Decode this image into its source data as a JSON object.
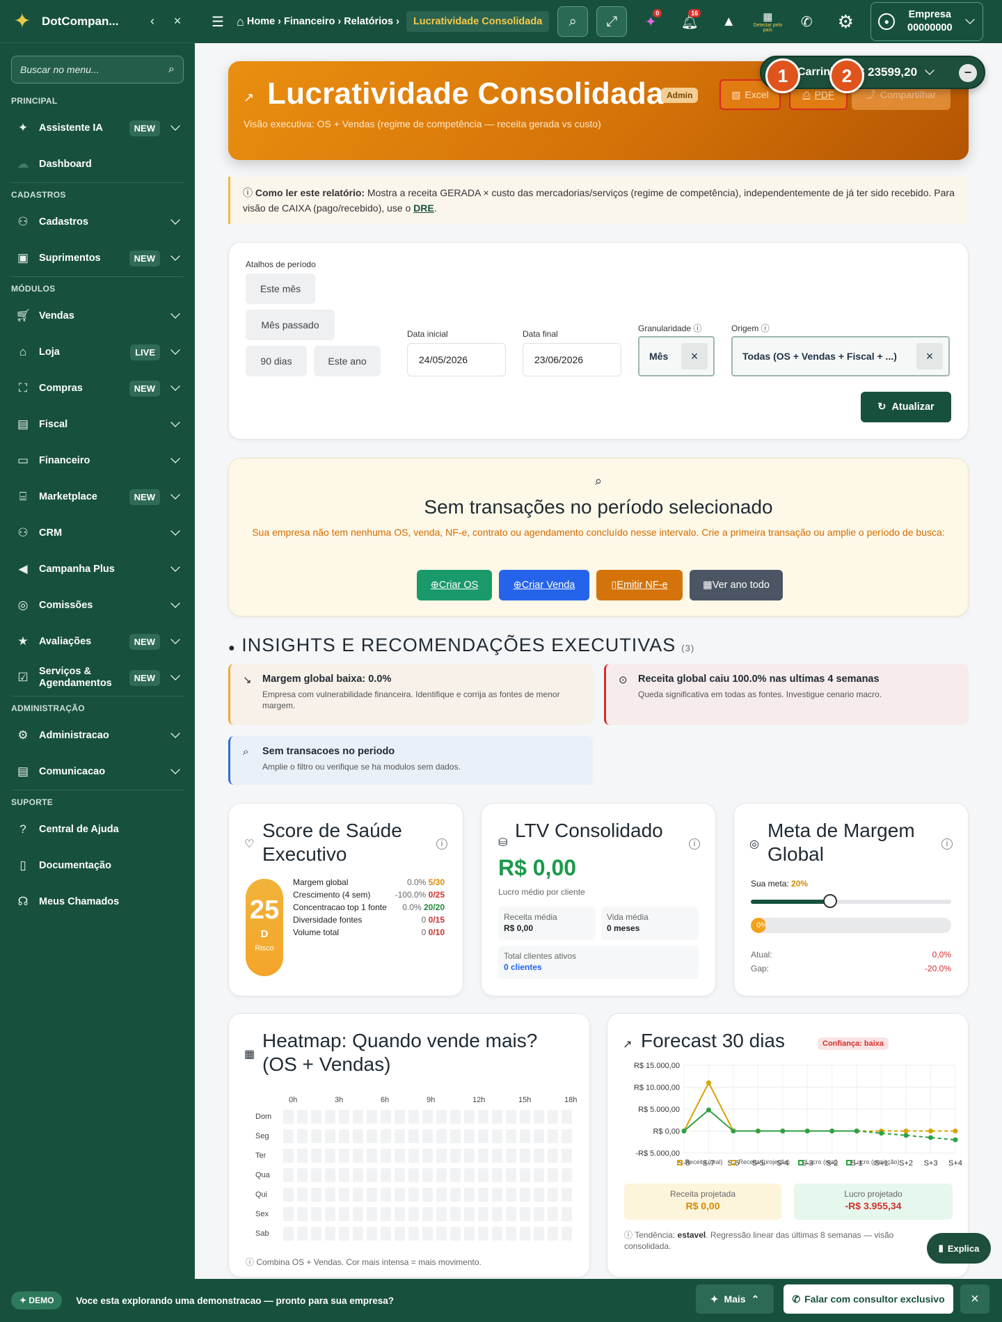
{
  "sidebar": {
    "brand": "DotCompan...",
    "search_placeholder": "Buscar no menu...",
    "sections": {
      "principal": "PRINCIPAL",
      "cadastros": "CADASTROS",
      "modulos": "MÓDULOS",
      "administracao": "ADMINISTRAÇÃO",
      "suporte": "SUPORTE"
    },
    "items": {
      "assistente": {
        "label": "Assistente IA",
        "badge": "NEW"
      },
      "dashboard": {
        "label": "Dashboard"
      },
      "cadastros": {
        "label": "Cadastros"
      },
      "suprimentos": {
        "label": "Suprimentos",
        "badge": "NEW"
      },
      "vendas": {
        "label": "Vendas"
      },
      "loja": {
        "label": "Loja",
        "badge": "LIVE"
      },
      "compras": {
        "label": "Compras",
        "badge": "NEW"
      },
      "fiscal": {
        "label": "Fiscal"
      },
      "financeiro": {
        "label": "Financeiro"
      },
      "marketplace": {
        "label": "Marketplace",
        "badge": "NEW"
      },
      "crm": {
        "label": "CRM"
      },
      "campanha": {
        "label": "Campanha Plus"
      },
      "comissoes": {
        "label": "Comissões"
      },
      "avaliacoes": {
        "label": "Avaliações",
        "badge": "NEW"
      },
      "servicos": {
        "label": "Serviços & Agendamentos",
        "badge": "NEW"
      },
      "administracao": {
        "label": "Administracao"
      },
      "comunicacao": {
        "label": "Comunicacao"
      },
      "ajuda": {
        "label": "Central de Ajuda"
      },
      "documentacao": {
        "label": "Documentação"
      },
      "chamados": {
        "label": "Meus Chamados"
      }
    }
  },
  "topbar": {
    "crumb_home": "Home",
    "crumb_financeiro": "Financeiro",
    "crumb_relatorios": "Relatórios",
    "crumb_active": "Lucratividade Consolidada",
    "notif_ai": "0",
    "notif_bell": "16",
    "detect_label": "Detectar pelo país",
    "company_label": "Empresa",
    "company_id": "00000000"
  },
  "cart": {
    "label": "Carrinho",
    "value": "R$ 23599,20"
  },
  "markers": {
    "one": "1",
    "two": "2"
  },
  "hero": {
    "title": "Lucratividade Consolidada",
    "badge": "Admin",
    "subtitle": "Visão executiva: OS + Vendas (regime de competência — receita gerada vs custo)",
    "btn_excel": "Excel",
    "btn_pdf": "PDF",
    "btn_share": "Compartilhar"
  },
  "info": {
    "bold": "Como ler este relatório:",
    "text": " Mostra a receita GERADA × custo das mercadorias/serviços (regime de competência), independentemente de já ter sido recebido. Para visão de CAIXA (pago/recebido), use o ",
    "link": "DRE",
    "end": "."
  },
  "filters": {
    "shortcuts_label": "Atalhos de período",
    "shortcuts": [
      "Este mês",
      "Mês passado",
      "90 dias",
      "Este ano"
    ],
    "start_label": "Data inicial",
    "start_value": "24/05/2026",
    "end_label": "Data final",
    "end_value": "23/06/2026",
    "gran_label": "Granularidade",
    "gran_value": "Mês",
    "origin_label": "Origem",
    "origin_value": "Todas (OS + Vendas + Fiscal + ...)",
    "update_btn": "Atualizar"
  },
  "empty": {
    "title": "Sem transações no período selecionado",
    "desc": "Sua empresa não tem nenhuma OS, venda, NF-e, contrato ou agendamento concluído nesse intervalo. Crie a primeira transação ou amplie o período de busca:",
    "btn_os": "Criar OS",
    "btn_venda": "Criar Venda",
    "btn_nfe": "Emitir NF-e",
    "btn_ano": "Ver ano todo"
  },
  "insights": {
    "title": "INSIGHTS E RECOMENDAÇÕES EXECUTIVAS",
    "count": "(3)",
    "items": [
      {
        "title": "Margem global baixa: 0.0%",
        "desc": "Empresa com vulnerabilidade financeira. Identifique e corrija as fontes de menor margem."
      },
      {
        "title": "Receita global caiu 100.0% nas ultimas 4 semanas",
        "desc": "Queda significativa em todas as fontes. Investigue cenario macro."
      },
      {
        "title": "Sem transacoes no periodo",
        "desc": "Amplie o filtro ou verifique se ha modulos sem dados."
      }
    ]
  },
  "score": {
    "title": "Score de Saúde Executivo",
    "value": "25",
    "grade": "D",
    "status": "Risco",
    "rows": [
      {
        "label": "Margem global",
        "pct": "0.0%",
        "pts": "5/30",
        "color": "#e08a00"
      },
      {
        "label": "Crescimento (4 sem)",
        "pct": "-100.0%",
        "pts": "0/25",
        "color": "#d0302c"
      },
      {
        "label": "Concentracao top 1 fonte",
        "pct": "0.0%",
        "pts": "20/20",
        "color": "#1c8a3a"
      },
      {
        "label": "Diversidade fontes",
        "pct": "0",
        "pts": "0/15",
        "color": "#d0302c"
      },
      {
        "label": "Volume total",
        "pct": "0",
        "pts": "0/10",
        "color": "#d0302c"
      }
    ]
  },
  "ltv": {
    "title": "LTV Consolidado",
    "value": "R$ 0,00",
    "sub": "Lucro médio por cliente",
    "rec_label": "Receita média",
    "rec_value": "R$ 0,00",
    "vida_label": "Vida média",
    "vida_value": "0 meses",
    "clients_label": "Total clientes ativos",
    "clients_value": "0 clientes"
  },
  "meta": {
    "title": "Meta de Margem Global",
    "goal_label": "Sua meta:",
    "goal_value": "20%",
    "goal_fraction": 0.2,
    "progress_label": "0%",
    "progress_fraction": 0,
    "atual_label": "Atual:",
    "atual_value": "0,0%",
    "gap_label": "Gap:",
    "gap_value": "-20.0%"
  },
  "heatmap": {
    "title": "Heatmap: Quando vende mais? (OS + Vendas)",
    "hours": [
      "0h",
      "3h",
      "6h",
      "9h",
      "12h",
      "15h",
      "18h"
    ],
    "days": [
      "Dom",
      "Seg",
      "Ter",
      "Qua",
      "Qui",
      "Sex",
      "Sab"
    ],
    "footer": "Combina OS + Vendas. Cor mais intensa = mais movimento."
  },
  "forecast": {
    "title": "Forecast 30 dias",
    "confidence": "Confiança: baixa",
    "rec_label": "Receita projetada",
    "rec_value": "R$ 0,00",
    "lucro_label": "Lucro projetado",
    "lucro_value": "-R$ 3.955,34",
    "trend_prefix": "Tendência: ",
    "trend_value": "estavel",
    "trend_suffix": ". Regressão linear das últimas 8 semanas — visão consolidada."
  },
  "chart_data": {
    "type": "line",
    "x": [
      "S-8",
      "S-7",
      "S-6",
      "S-5",
      "S-4",
      "S-3",
      "S-2",
      "S-1",
      "S+1",
      "S+2",
      "S+3",
      "S+4"
    ],
    "ylabels": [
      "R$ 15.000,00",
      "R$ 10.000,00",
      "R$ 5.000,00",
      "R$ 0,00",
      "-R$ 5.000,00"
    ],
    "ylim": [
      -5000,
      15000
    ],
    "series": [
      {
        "name": "Receita (real)",
        "color": "#d9a100",
        "values": [
          0,
          11000,
          0,
          0,
          0,
          0,
          0,
          0,
          null,
          null,
          null,
          null
        ]
      },
      {
        "name": "Receita (projeção)",
        "color": "#d9a100",
        "dashed": true,
        "values": [
          null,
          null,
          null,
          null,
          null,
          null,
          null,
          0,
          0,
          0,
          0,
          0
        ]
      },
      {
        "name": "Lucro (real)",
        "color": "#2ea043",
        "values": [
          0,
          4800,
          0,
          0,
          0,
          0,
          0,
          0,
          null,
          null,
          null,
          null
        ]
      },
      {
        "name": "Lucro (projeção)",
        "color": "#2ea043",
        "dashed": true,
        "values": [
          null,
          null,
          null,
          null,
          null,
          null,
          null,
          0,
          -500,
          -1000,
          -1500,
          -2000
        ]
      }
    ]
  },
  "demo": {
    "badge": "DEMO",
    "text": "Voce esta explorando uma demonstracao — pronto para sua empresa?",
    "btn_mais": "Mais",
    "btn_falar": "Falar com consultor exclusivo",
    "explica": "Explica"
  }
}
